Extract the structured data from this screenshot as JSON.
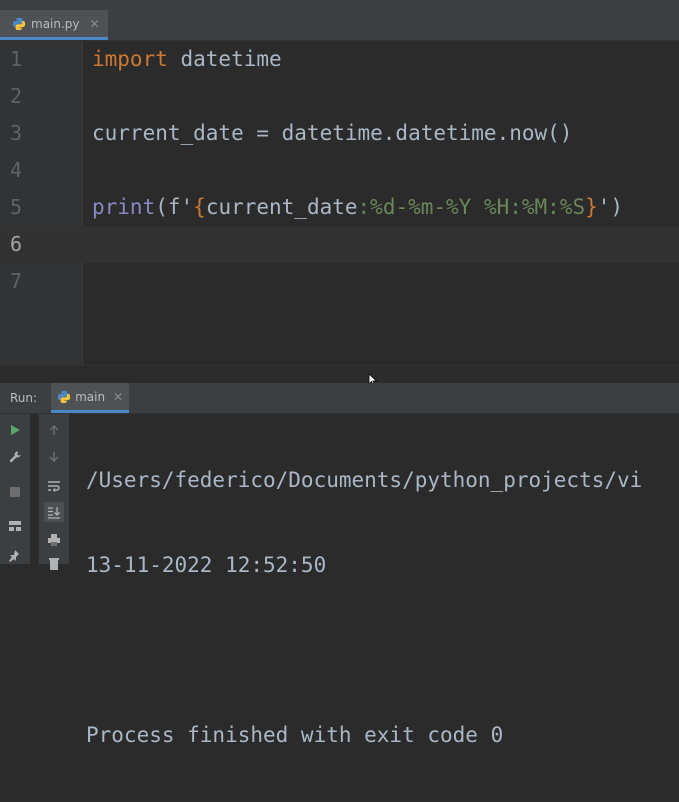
{
  "editor": {
    "tab": {
      "filename": "main.py",
      "icon": "python-file-icon"
    },
    "lines": [
      {
        "number": "1"
      },
      {
        "number": "2"
      },
      {
        "number": "3"
      },
      {
        "number": "4"
      },
      {
        "number": "5"
      },
      {
        "number": "6"
      },
      {
        "number": "7"
      }
    ],
    "code": {
      "l1_keyword": "import",
      "l1_rest": " datetime",
      "l3": "current_date = datetime.datetime.now()",
      "l5_print": "print",
      "l5_open": "(f'",
      "l5_brace_open": "{",
      "l5_var": "current_date",
      "l5_fmt": ":%d-%m-%Y %H:%M:%S",
      "l5_brace_close": "}",
      "l5_close": "')"
    },
    "current_line": "6"
  },
  "run_panel": {
    "label": "Run:",
    "tab_label": "main",
    "output": [
      "/Users/federico/Documents/python_projects/vi",
      "13-11-2022 12:52:50",
      "",
      "Process finished with exit code 0"
    ]
  },
  "colors": {
    "background": "#2b2b2b",
    "keyword": "#cc7832",
    "builtin": "#8888c6",
    "string": "#6a8759",
    "text": "#a9b7c6",
    "run_green": "#59a869"
  }
}
